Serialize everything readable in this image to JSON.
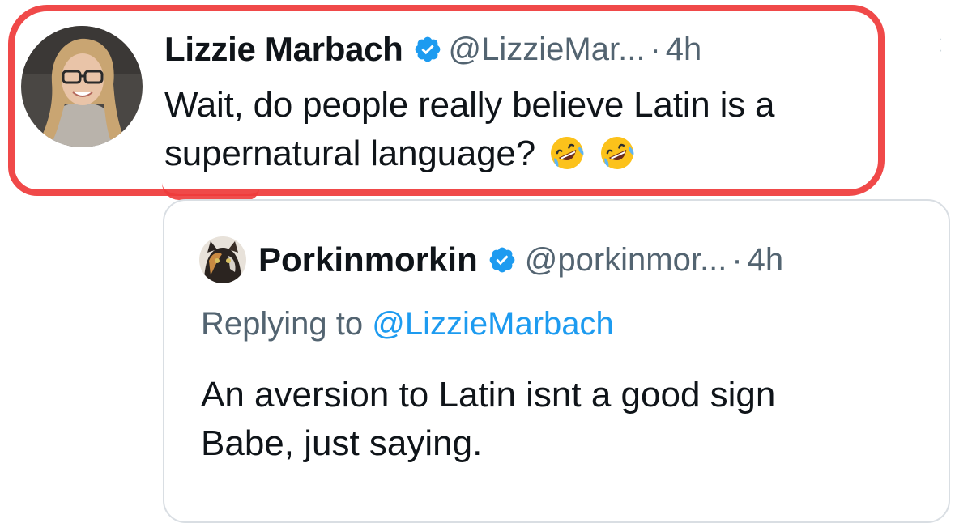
{
  "main_tweet": {
    "display_name": "Lizzie Marbach",
    "handle": "@LizzieMar...",
    "separator": "·",
    "time": "4h",
    "text": "Wait, do people really believe Latin is a supernatural language?",
    "emojis": [
      "rolling-on-floor-laughing",
      "rolling-on-floor-laughing"
    ],
    "highlight_color": "#ef3b3b"
  },
  "quoted_tweet": {
    "display_name": "Porkinmorkin",
    "handle": "@porkinmor...",
    "separator": "·",
    "time": "4h",
    "replying_prefix": "Replying to",
    "replying_mention": "@LizzieMarbach",
    "text_line1": "An aversion to Latin isnt a good sign",
    "text_line2": "Babe, just saying."
  },
  "colors": {
    "verified": "#1d9bf0",
    "secondary_text": "#536471",
    "mention": "#1d9bf0",
    "border": "#d9dee3"
  }
}
